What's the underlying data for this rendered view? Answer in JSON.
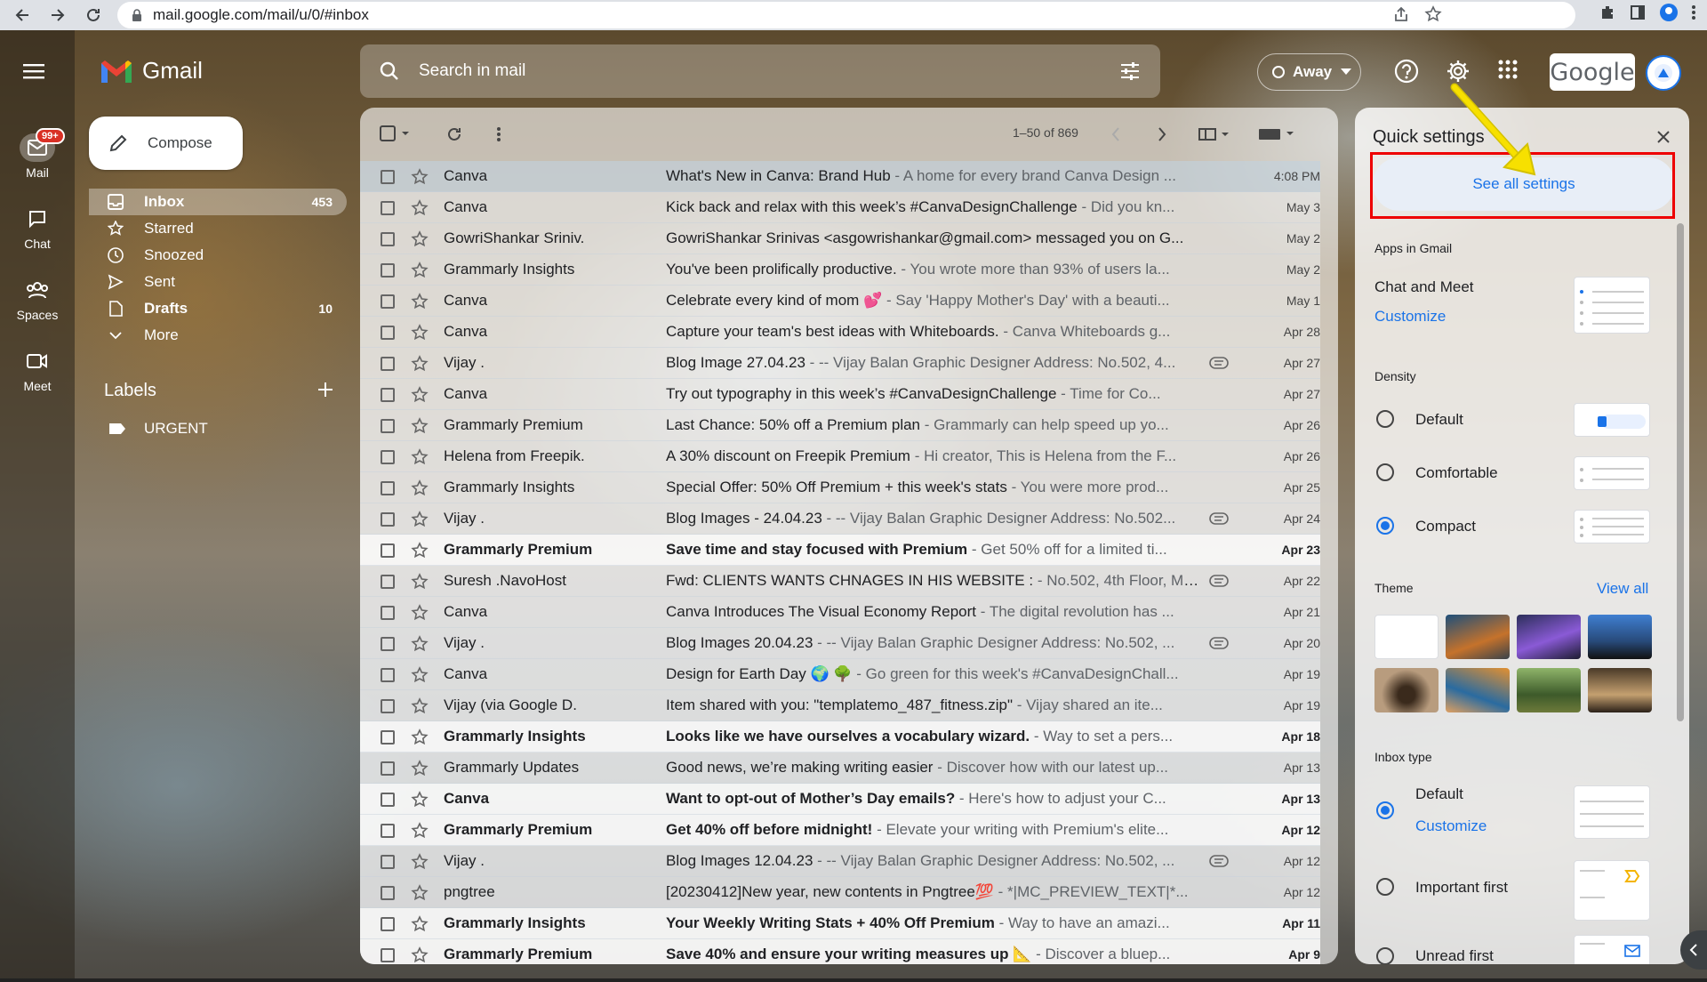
{
  "browser": {
    "url": "mail.google.com/mail/u/0/#inbox"
  },
  "rail": {
    "mail_label": "Mail",
    "mail_badge": "99+",
    "chat_label": "Chat",
    "spaces_label": "Spaces",
    "meet_label": "Meet"
  },
  "app": {
    "name": "Gmail",
    "compose_label": "Compose"
  },
  "nav": {
    "items": [
      {
        "label": "Inbox",
        "count": "453",
        "icon": "inbox-icon"
      },
      {
        "label": "Starred",
        "count": "",
        "icon": "star-icon"
      },
      {
        "label": "Snoozed",
        "count": "",
        "icon": "clock-icon"
      },
      {
        "label": "Sent",
        "count": "",
        "icon": "send-icon"
      },
      {
        "label": "Drafts",
        "count": "10",
        "icon": "draft-icon"
      },
      {
        "label": "More",
        "count": "",
        "icon": "chevron-down-icon"
      }
    ],
    "labels_header": "Labels",
    "labels": [
      {
        "label": "URGENT"
      }
    ]
  },
  "search": {
    "placeholder": "Search in mail"
  },
  "status": {
    "label": "Away"
  },
  "brand": {
    "google": "Google"
  },
  "toolbar": {
    "pager": "1–50 of 869"
  },
  "emails": [
    {
      "sender": "Canva",
      "subject": "What's New in Canva: Brand Hub",
      "snippet": " - A home for every brand Canva Design ...",
      "date": "4:08 PM",
      "unread": false,
      "attach": false
    },
    {
      "sender": "Canva",
      "subject": "Kick back and relax with this week’s #CanvaDesignChallenge",
      "snippet": " - Did you kn...",
      "date": "May 3",
      "unread": false,
      "attach": false
    },
    {
      "sender": "GowriShankar Sriniv.",
      "subject": "GowriShankar Srinivas <asgowrishankar@gmail.com> messaged you on G...",
      "snippet": "",
      "date": "May 2",
      "unread": false,
      "attach": false
    },
    {
      "sender": "Grammarly Insights",
      "subject": "You've been prolifically productive.",
      "snippet": " - You wrote more than 93% of users la...",
      "date": "May 2",
      "unread": false,
      "attach": false
    },
    {
      "sender": "Canva",
      "subject": "Celebrate every kind of mom 💕",
      "snippet": " - Say 'Happy Mother's Day' with a beauti...",
      "date": "May 1",
      "unread": false,
      "attach": false
    },
    {
      "sender": "Canva",
      "subject": "Capture your team's best ideas with Whiteboards.",
      "snippet": " - Canva Whiteboards g...",
      "date": "Apr 28",
      "unread": false,
      "attach": false
    },
    {
      "sender": "Vijay .",
      "subject": "Blog Image 27.04.23",
      "snippet": " - -- Vijay Balan Graphic Designer Address: No.502, 4...",
      "date": "Apr 27",
      "unread": false,
      "attach": true
    },
    {
      "sender": "Canva",
      "subject": "Try out typography in this week’s #CanvaDesignChallenge",
      "snippet": " - Time for Co...",
      "date": "Apr 27",
      "unread": false,
      "attach": false
    },
    {
      "sender": "Grammarly Premium",
      "subject": "Last Chance: 50% off a Premium plan",
      "snippet": " - Grammarly can help speed up yo...",
      "date": "Apr 26",
      "unread": false,
      "attach": false
    },
    {
      "sender": "Helena from Freepik.",
      "subject": "A 30% discount on Freepik Premium",
      "snippet": " - Hi creator, This is Helena from the F...",
      "date": "Apr 26",
      "unread": false,
      "attach": false
    },
    {
      "sender": "Grammarly Insights",
      "subject": "Special Offer: 50% Off Premium + this week's stats",
      "snippet": " - You were more prod...",
      "date": "Apr 25",
      "unread": false,
      "attach": false
    },
    {
      "sender": "Vijay .",
      "subject": "Blog Images - 24.04.23",
      "snippet": " - -- Vijay Balan Graphic Designer Address: No.502...",
      "date": "Apr 24",
      "unread": false,
      "attach": true
    },
    {
      "sender": "Grammarly Premium",
      "subject": "Save time and stay focused with Premium",
      "snippet": " - Get 50% off for a limited ti...",
      "date": "Apr 23",
      "unread": true,
      "attach": false
    },
    {
      "sender": "Suresh .NavoHost",
      "subject": "Fwd: CLIENTS WANTS CHNAGES IN HIS WEBSITE :",
      "snippet": " - No.502, 4th Floor, Ma...",
      "date": "Apr 22",
      "unread": false,
      "attach": true
    },
    {
      "sender": "Canva",
      "subject": "Canva Introduces The Visual Economy Report",
      "snippet": " - The digital revolution has ...",
      "date": "Apr 21",
      "unread": false,
      "attach": false
    },
    {
      "sender": "Vijay .",
      "subject": "Blog Images 20.04.23",
      "snippet": " - -- Vijay Balan Graphic Designer Address: No.502, ...",
      "date": "Apr 20",
      "unread": false,
      "attach": true
    },
    {
      "sender": "Canva",
      "subject": "Design for Earth Day 🌍 🌳",
      "snippet": " - Go green for this week's #CanvaDesignChall...",
      "date": "Apr 19",
      "unread": false,
      "attach": false
    },
    {
      "sender": "Vijay (via Google D.",
      "subject": "Item shared with you: \"templatemo_487_fitness.zip\"",
      "snippet": " - Vijay shared an ite...",
      "date": "Apr 19",
      "unread": false,
      "attach": false
    },
    {
      "sender": "Grammarly Insights",
      "subject": "Looks like we have ourselves a vocabulary wizard.",
      "snippet": " - Way to set a pers...",
      "date": "Apr 18",
      "unread": true,
      "attach": false
    },
    {
      "sender": "Grammarly Updates",
      "subject": "Good news, we’re making writing easier",
      "snippet": " - Discover how with our latest up...",
      "date": "Apr 13",
      "unread": false,
      "attach": false
    },
    {
      "sender": "Canva",
      "subject": "Want to opt-out of Mother’s Day emails?",
      "snippet": " - Here's how to adjust your C...",
      "date": "Apr 13",
      "unread": true,
      "attach": false
    },
    {
      "sender": "Grammarly Premium",
      "subject": "Get 40% off before midnight!",
      "snippet": " - Elevate your writing with Premium's elite...",
      "date": "Apr 12",
      "unread": true,
      "attach": false
    },
    {
      "sender": "Vijay .",
      "subject": "Blog Images 12.04.23",
      "snippet": " - -- Vijay Balan Graphic Designer Address: No.502, ...",
      "date": "Apr 12",
      "unread": false,
      "attach": true
    },
    {
      "sender": "pngtree",
      "subject": "[20230412]New year, new contents in Pngtree💯",
      "snippet": " - *|MC_PREVIEW_TEXT|*...",
      "date": "Apr 12",
      "unread": false,
      "attach": false
    },
    {
      "sender": "Grammarly Insights",
      "subject": "Your Weekly Writing Stats + 40% Off Premium",
      "snippet": " - Way to have an amazi...",
      "date": "Apr 11",
      "unread": true,
      "attach": false
    },
    {
      "sender": "Grammarly Premium",
      "subject": "Save 40% and ensure your writing measures up 📐",
      "snippet": " - Discover a bluep...",
      "date": "Apr 9",
      "unread": true,
      "attach": false
    }
  ],
  "quick_settings": {
    "title": "Quick settings",
    "see_all": "See all settings",
    "apps_header": "Apps in Gmail",
    "apps_item": "Chat and Meet",
    "apps_customize": "Customize",
    "density_header": "Density",
    "density_options": [
      "Default",
      "Comfortable",
      "Compact"
    ],
    "density_selected": "Compact",
    "theme_header": "Theme",
    "theme_view_all": "View all",
    "inbox_type_header": "Inbox type",
    "inbox_default": "Default",
    "inbox_customize": "Customize",
    "inbox_important": "Important first",
    "inbox_unread_partial": "Unread first"
  },
  "colors": {
    "accent": "#1a73e8",
    "badge": "#d93025",
    "highlight_box": "#ee0000",
    "arrow": "#f7e000"
  }
}
